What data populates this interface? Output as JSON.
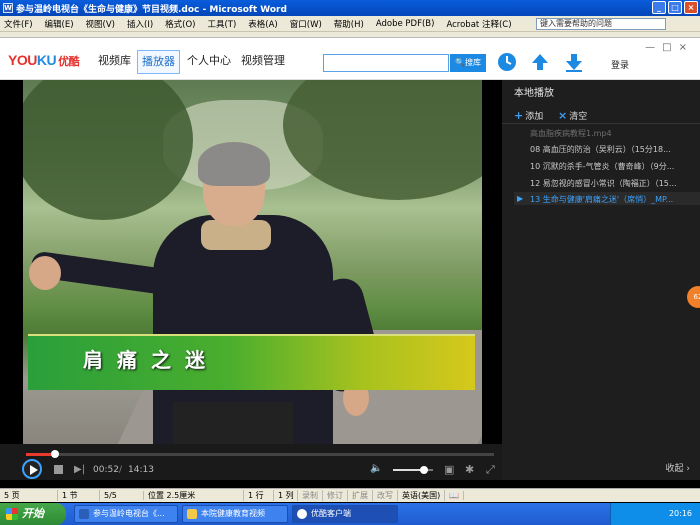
{
  "word": {
    "title": "参与温岭电视台《生命与健康》节目视频.doc - Microsoft Word",
    "menu": [
      "文件(F)",
      "编辑(E)",
      "视图(V)",
      "插入(I)",
      "格式(O)",
      "工具(T)",
      "表格(A)",
      "窗口(W)",
      "帮助(H)",
      "Adobe PDF(B)",
      "Acrobat 注释(C)"
    ],
    "help_placeholder": "键入需要帮助的问题",
    "status": {
      "page": "5 页",
      "section": "1 节",
      "pages": "5/5",
      "position": "位置 2.5厘米",
      "line": "1 行",
      "col": "1 列",
      "rec": "录制",
      "trk": "修订",
      "ext": "扩展",
      "ovr": "改写",
      "lang": "英语(美国)"
    }
  },
  "youku": {
    "logo_main": "YOU",
    "logo_ku": "KU",
    "logo_cn": "优酷",
    "nav": [
      "视频库",
      "播放器",
      "个人中心",
      "视频管理"
    ],
    "nav_active": 1,
    "search_button": "搜库",
    "login": "登录"
  },
  "video": {
    "caption": "肩痛之迷"
  },
  "playlist": {
    "title": "本地播放",
    "add": "添加",
    "clear": "清空",
    "items": [
      "高血脂疾病教程1.mp4",
      "08 高血压的防治（吴利云）（15分18...",
      "10 沉默的杀手-气管炎（曹奇峰）（9分...",
      "12 易忽视的感冒小常识（陶福正）（15...",
      "13 生命与健康'肩痛之迷'（席悄）_MP..."
    ],
    "active_index": 4,
    "bubble": "62",
    "collapse": "收起"
  },
  "player": {
    "time_current": "00:52",
    "time_sep": "/",
    "time_total": "14:13",
    "progress": 0.062,
    "volume": 0.78
  },
  "taskbar": {
    "start": "开始",
    "tasks": [
      "参与温岭电视台《...",
      "本院健康教育视频",
      "优酷客户端"
    ],
    "active_task": 2,
    "clock": "20:16"
  },
  "colors": {
    "accent": "#3ca3ff",
    "progress": "#e83b2e",
    "youku_red": "#e5322d",
    "youku_blue": "#1e8be0"
  }
}
